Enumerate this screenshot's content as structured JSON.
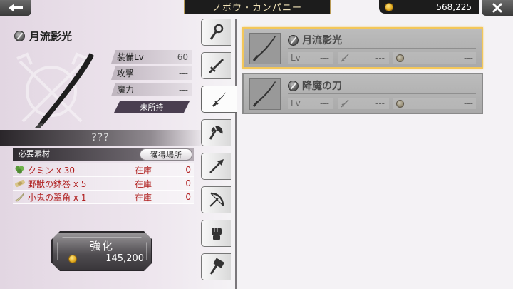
{
  "header": {
    "title": "ノボウ・カンパニー",
    "money": "568,225"
  },
  "item": {
    "name": "月流影光",
    "stats": [
      {
        "label": "装備Lv",
        "value": "60"
      },
      {
        "label": "攻撃",
        "value": "---"
      },
      {
        "label": "魔力",
        "value": "---"
      }
    ],
    "status": "未所持",
    "unknown_label": "???"
  },
  "materials": {
    "header": "必要素材",
    "acquire_button": "獲得場所",
    "rows": [
      {
        "name": "クミン x 30",
        "stock_label": "在庫",
        "count": "0",
        "icon": "leaf-icon"
      },
      {
        "name": "野獣の鉢巻 x 5",
        "stock_label": "在庫",
        "count": "0",
        "icon": "bandage-icon"
      },
      {
        "name": "小鬼の翠角 x 1",
        "stock_label": "在庫",
        "count": "0",
        "icon": "horn-icon"
      }
    ]
  },
  "enhance": {
    "label": "強化",
    "cost": "145,200"
  },
  "tabs": [
    {
      "icon": "staff-icon",
      "active": false
    },
    {
      "icon": "sword-icon",
      "active": false
    },
    {
      "icon": "katana-icon",
      "active": true
    },
    {
      "icon": "axe-icon",
      "active": false
    },
    {
      "icon": "spear-icon",
      "active": false
    },
    {
      "icon": "bow-icon",
      "active": false
    },
    {
      "icon": "fist-icon",
      "active": false
    },
    {
      "icon": "hammer-icon",
      "active": false
    }
  ],
  "list": [
    {
      "name": "月流影光",
      "lv_label": "Lv",
      "lv": "---",
      "atk": "---",
      "mag": "---",
      "selected": true
    },
    {
      "name": "降魔の刀",
      "lv_label": "Lv",
      "lv": "---",
      "atk": "---",
      "mag": "---",
      "selected": false
    }
  ],
  "colors": {
    "accent_gold": "#f3c75a",
    "missing_red": "#b01e1e"
  }
}
